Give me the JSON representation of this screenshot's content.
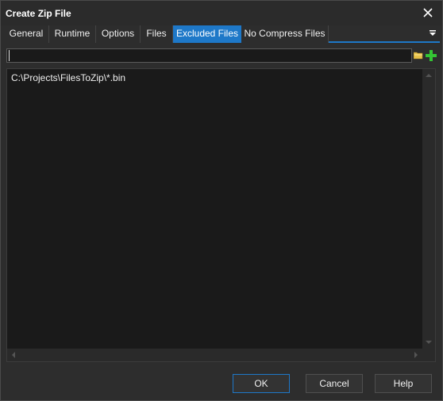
{
  "window": {
    "title": "Create Zip File"
  },
  "tabs": [
    {
      "label": "General",
      "active": false
    },
    {
      "label": "Runtime",
      "active": false
    },
    {
      "label": "Options",
      "active": false
    },
    {
      "label": "Files",
      "active": false
    },
    {
      "label": "Excluded Files",
      "active": true
    },
    {
      "label": "No Compress Files",
      "active": false
    }
  ],
  "path_input": {
    "value": "",
    "placeholder": ""
  },
  "excluded_files": [
    "C:\\Projects\\FilesToZip\\*.bin"
  ],
  "buttons": {
    "ok": "OK",
    "cancel": "Cancel",
    "help": "Help"
  },
  "colors": {
    "accent": "#1e78c8",
    "add_green": "#34c434",
    "folder_yellow": "#e8c24a"
  },
  "icons": {
    "close": "close-icon",
    "tab_menu": "tab-menu-icon",
    "browse": "folder-icon",
    "add": "plus-icon"
  }
}
